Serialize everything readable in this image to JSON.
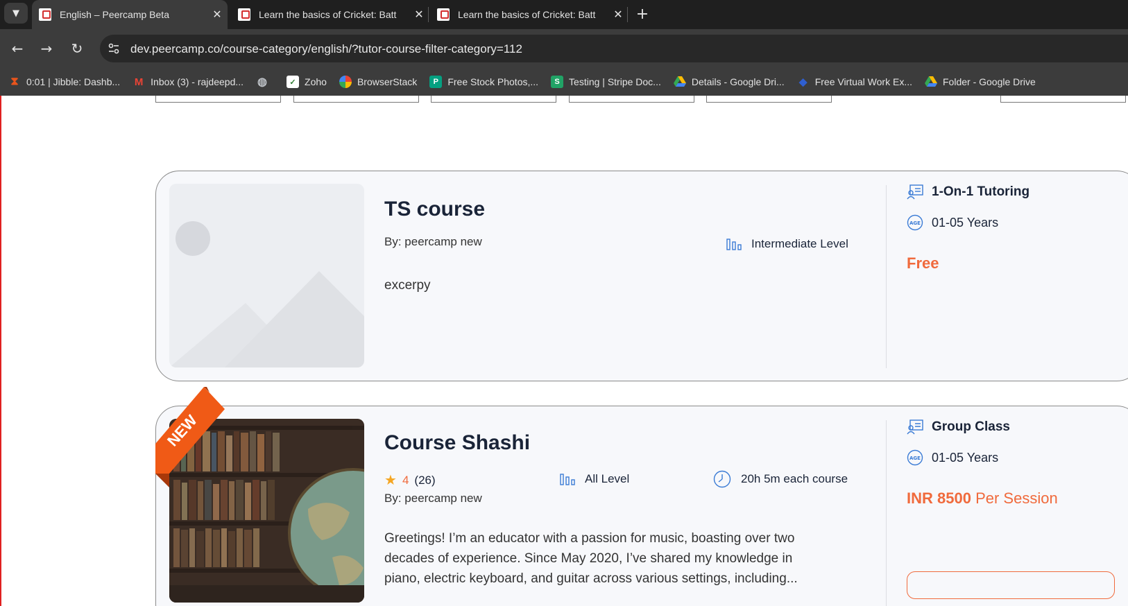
{
  "browser": {
    "tabs": [
      {
        "title": "English – Peercamp Beta",
        "active": true
      },
      {
        "title": "Learn the basics of Cricket: Batt",
        "active": false
      },
      {
        "title": "Learn the basics of Cricket: Batt",
        "active": false
      }
    ],
    "url": "dev.peercamp.co/course-category/english/?tutor-course-filter-category=112",
    "bookmarks": [
      {
        "label": "0:01 | Jibble: Dashb...",
        "icon": "jibble-icon",
        "color": "#e8541c"
      },
      {
        "label": "Inbox (3) - rajdeepd...",
        "icon": "gmail-icon",
        "color": "#d93025"
      },
      {
        "label": "",
        "icon": "globe-icon",
        "color": "#9aa0a6"
      },
      {
        "label": "Zoho",
        "icon": "zoho-icon",
        "color": "#ffffff"
      },
      {
        "label": "BrowserStack",
        "icon": "browserstack-icon",
        "color": "#f4b400"
      },
      {
        "label": "Free Stock Photos,...",
        "icon": "pexels-icon",
        "color": "#05a081"
      },
      {
        "label": "Testing | Stripe Doc...",
        "icon": "stripe-icon",
        "color": "#21a366"
      },
      {
        "label": "Details - Google Dri...",
        "icon": "google-drive-icon",
        "color": "#fbbc04"
      },
      {
        "label": "Free Virtual Work Ex...",
        "icon": "forage-icon",
        "color": "#1d4fd8"
      },
      {
        "label": "Folder - Google Drive",
        "icon": "google-drive-icon",
        "color": "#fbbc04"
      }
    ]
  },
  "courses": [
    {
      "title": "TS course",
      "by": "By: peercamp new",
      "level": "Intermediate Level",
      "excerpt": "excerpy",
      "type": "1-On-1 Tutoring",
      "age": "01-05 Years",
      "price": "Free"
    },
    {
      "badge": "NEW",
      "title": "Course Shashi",
      "rating": "4",
      "rating_count": "(26)",
      "by": "By: peercamp new",
      "level": "All Level",
      "duration": "20h 5m each course",
      "excerpt_lines": [
        "Greetings! I’m an educator with a passion for music, boasting over two",
        "decades of experience. Since May 2020, I’ve shared my knowledge in",
        "piano, electric keyboard, and guitar across various settings, including..."
      ],
      "type": "Group Class",
      "age": "01-05 Years",
      "price_amount": "INR 8500",
      "price_unit": "Per Session"
    }
  ],
  "colors": {
    "accent": "#f06a3c",
    "icon_blue": "#3a7bd5",
    "ribbon": "#f05a16",
    "heading": "#1a2438"
  }
}
